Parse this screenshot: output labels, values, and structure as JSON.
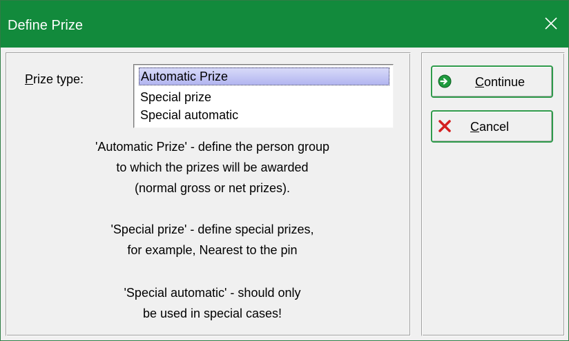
{
  "window": {
    "title": "Define Prize",
    "close_icon": "close-icon"
  },
  "form": {
    "prize_type_label_first": "P",
    "prize_type_label_rest": "rize type:",
    "options": [
      "Automatic Prize",
      "Special prize",
      "Special automatic"
    ],
    "selected": "Automatic Prize"
  },
  "description": {
    "lines": [
      "'Automatic Prize' - define the person group",
      "to which the prizes will be awarded",
      "(normal gross or net prizes).",
      "'Special prize' - define special prizes,",
      "for example, Nearest to the pin",
      "'Special automatic' - should only",
      "be used in special cases!"
    ]
  },
  "buttons": {
    "continue_first": "C",
    "continue_rest": "ontinue",
    "continue_icon": "continue-arrow-icon",
    "cancel_first": "C",
    "cancel_rest": "ancel",
    "cancel_icon": "cancel-x-icon"
  },
  "colors": {
    "titlebar": "#128a3c",
    "button_border": "#2e9a4a",
    "selection": "#b2b5f0",
    "cancel_red": "#d42020"
  }
}
